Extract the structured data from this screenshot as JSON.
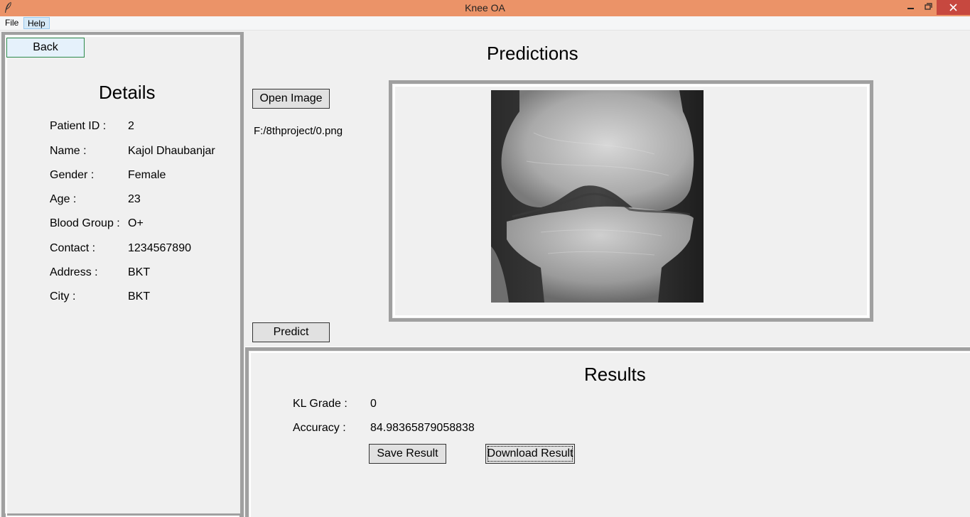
{
  "window": {
    "title": "Knee OA",
    "title_bar_color": "#eb9368",
    "controls": [
      "minimize-icon",
      "restore-icon",
      "close-icon"
    ]
  },
  "menu": {
    "file": "File",
    "help": "Help"
  },
  "details": {
    "back_label": "Back",
    "heading": "Details",
    "rows": [
      {
        "label": "Patient ID :",
        "value": "2"
      },
      {
        "label": "Name :",
        "value": "Kajol Dhaubanjar"
      },
      {
        "label": "Gender :",
        "value": "Female"
      },
      {
        "label": "Age :",
        "value": "23"
      },
      {
        "label": "Blood Group :",
        "value": "O+"
      },
      {
        "label": "Contact :",
        "value": "1234567890"
      },
      {
        "label": "Address :",
        "value": "BKT"
      },
      {
        "label": "City :",
        "value": "BKT"
      }
    ]
  },
  "predictions": {
    "heading": "Predictions",
    "open_image_label": "Open Image",
    "file_path": "F:/8thproject/0.png",
    "predict_label": "Predict",
    "image": "knee-xray-image"
  },
  "results": {
    "heading": "Results",
    "kl_grade_label": "KL Grade :",
    "kl_grade_value": "0",
    "accuracy_label": "Accuracy :",
    "accuracy_value": "84.98365879058838",
    "save_label": "Save Result",
    "download_label": "Download Result"
  }
}
